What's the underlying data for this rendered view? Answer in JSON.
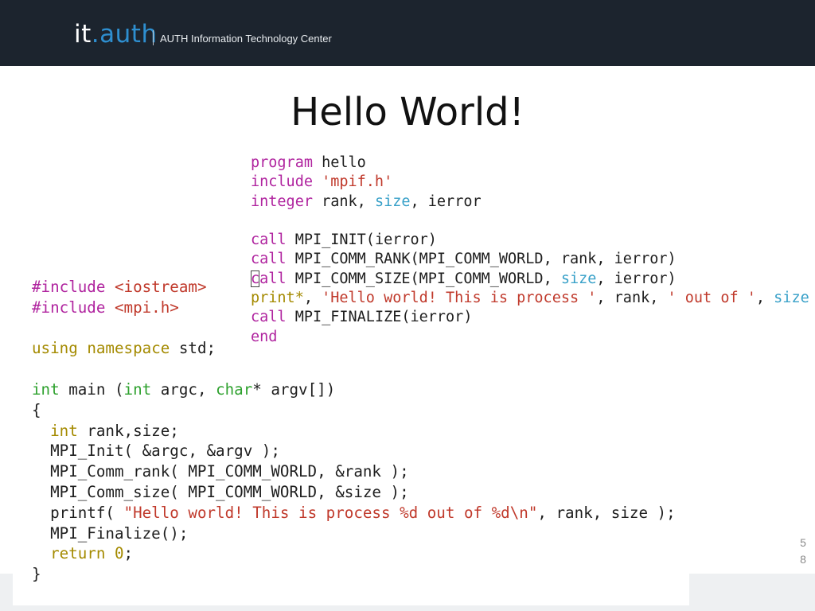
{
  "header": {
    "logo_it": "it",
    "logo_dot": ".",
    "logo_auth": "auth",
    "subtitle": "AUTH Information Technology Center"
  },
  "slide": {
    "title": "Hello World!",
    "page_number_line1": "5",
    "page_number_line2": "8"
  },
  "fortran_code": {
    "l1": {
      "a": "program",
      "b": " hello"
    },
    "l2": {
      "a": "include",
      "b": " ",
      "c": "'mpif.h'"
    },
    "l3": {
      "a": "integer",
      "b": " rank, ",
      "c": "size",
      "d": ", ierror"
    },
    "l5": {
      "a": "call",
      "b": " MPI_INIT(ierror)"
    },
    "l6": {
      "a": "call",
      "b": " MPI_COMM_RANK(MPI_COMM_WORLD, rank, ierror)"
    },
    "l7": {
      "a": "call",
      "b": " MPI_COMM_SIZE(MPI_COMM_WORLD, ",
      "c": "size",
      "d": ", ierror)"
    },
    "l8": {
      "a": "print*",
      "b": ", ",
      "c": "'Hello world! This is process '",
      "d": ", rank, ",
      "e": "' out of '",
      "f": ", ",
      "g": "size"
    },
    "l9": {
      "a": "call",
      "b": " MPI_FINALIZE(ierror)"
    },
    "l10": {
      "a": "end"
    }
  },
  "cpp_code": {
    "l1": {
      "a": "#include",
      "b": " <iostream>"
    },
    "l2": {
      "a": "#include",
      "b": " <mpi.h>"
    },
    "l4": {
      "a": "using",
      "b": " ",
      "c": "namespace",
      "d": " std;"
    },
    "l6": {
      "a": "int",
      "b": " main (",
      "c": "int",
      "d": " argc, ",
      "e": "char",
      "f": "* argv[])"
    },
    "l7": {
      "a": "{"
    },
    "l8": {
      "a": "  ",
      "b": "int",
      "c": " rank,size;"
    },
    "l9": {
      "a": "  MPI_Init( &argc, &argv );"
    },
    "l10": {
      "a": "  MPI_Comm_rank( MPI_COMM_WORLD, &rank );"
    },
    "l11": {
      "a": "  MPI_Comm_size( MPI_COMM_WORLD, &size );"
    },
    "l12": {
      "a": "  printf( ",
      "b": "\"Hello world! This is process %d out of %d\\n\"",
      "c": ", rank, size );"
    },
    "l13": {
      "a": "  MPI_Finalize();"
    },
    "l14": {
      "a": "  ",
      "b": "return",
      "c": " ",
      "d": "0",
      "e": ";"
    },
    "l15": {
      "a": "}"
    }
  },
  "colors": {
    "header_bg": "#1c242e",
    "brand_blue": "#2e8fd0",
    "keyword_purple": "#b0249f",
    "type_green": "#2ea12e",
    "string_red": "#c0392b",
    "highlight_blue": "#37a0c8",
    "preprocessor_olive": "#a48a00"
  }
}
